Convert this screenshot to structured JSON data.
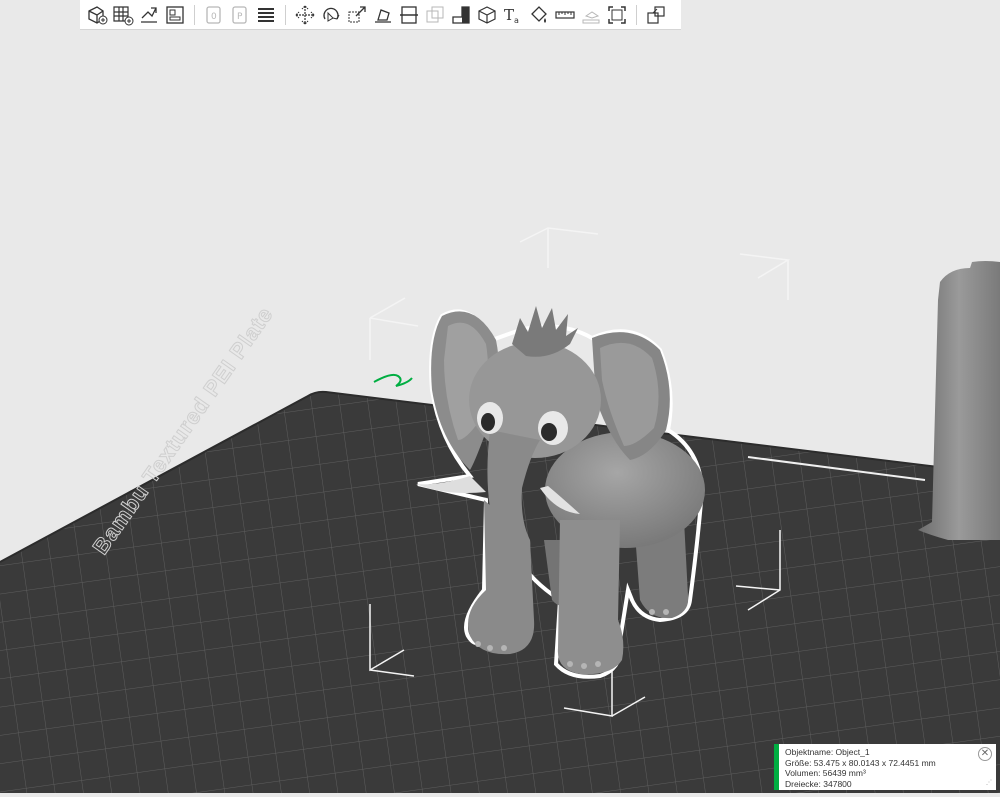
{
  "toolbar": {
    "buttons": [
      {
        "name": "add-object",
        "icon": "cube-plus-icon",
        "enabled": true
      },
      {
        "name": "add-plate",
        "icon": "grid-plus-icon",
        "enabled": true
      },
      {
        "name": "auto-orient",
        "icon": "orient-icon",
        "enabled": true
      },
      {
        "name": "arrange",
        "icon": "arrange-icon",
        "enabled": true
      },
      {
        "name": "split-objects",
        "icon": "split-objects-icon",
        "enabled": false
      },
      {
        "name": "split-parts",
        "icon": "split-parts-icon",
        "enabled": false
      },
      {
        "name": "variable-layer-height",
        "icon": "layers-icon",
        "enabled": true
      },
      {
        "name": "move",
        "icon": "move-icon",
        "enabled": true
      },
      {
        "name": "rotate",
        "icon": "rotate-icon",
        "enabled": true
      },
      {
        "name": "scale",
        "icon": "scale-icon",
        "enabled": true
      },
      {
        "name": "lay-on-face",
        "icon": "lay-on-face-icon",
        "enabled": true
      },
      {
        "name": "cut",
        "icon": "cut-icon",
        "enabled": true
      },
      {
        "name": "boolean",
        "icon": "boolean-icon",
        "enabled": false
      },
      {
        "name": "support-paint",
        "icon": "support-paint-icon",
        "enabled": true
      },
      {
        "name": "seam-paint",
        "icon": "seam-paint-icon",
        "enabled": true
      },
      {
        "name": "text-emboss",
        "icon": "text-icon",
        "enabled": true
      },
      {
        "name": "color-paint",
        "icon": "color-paint-icon",
        "enabled": true
      },
      {
        "name": "measure",
        "icon": "ruler-icon",
        "enabled": true
      },
      {
        "name": "assembly",
        "icon": "assembly-icon",
        "enabled": false
      },
      {
        "name": "bounding-box",
        "icon": "bounding-box-icon",
        "enabled": true
      },
      {
        "name": "view-explode",
        "icon": "explode-icon",
        "enabled": true
      }
    ]
  },
  "plate": {
    "label": "Bambu Textured PEI Plate"
  },
  "object_info": {
    "name_line": "Objektname: Object_1",
    "size_line": "Größe: 53.475 x 80.0143 x 72.4451 mm",
    "volume_line": "Volumen: 56439 mm³",
    "triangles_line": "Dreiecke: 347800",
    "close_symbol": "✕",
    "grip_symbol": "⋰"
  },
  "colors": {
    "accent": "#00ae42",
    "background": "#e9e9e9",
    "plate": "#3c3c3c",
    "model": "#8f8f8f"
  }
}
